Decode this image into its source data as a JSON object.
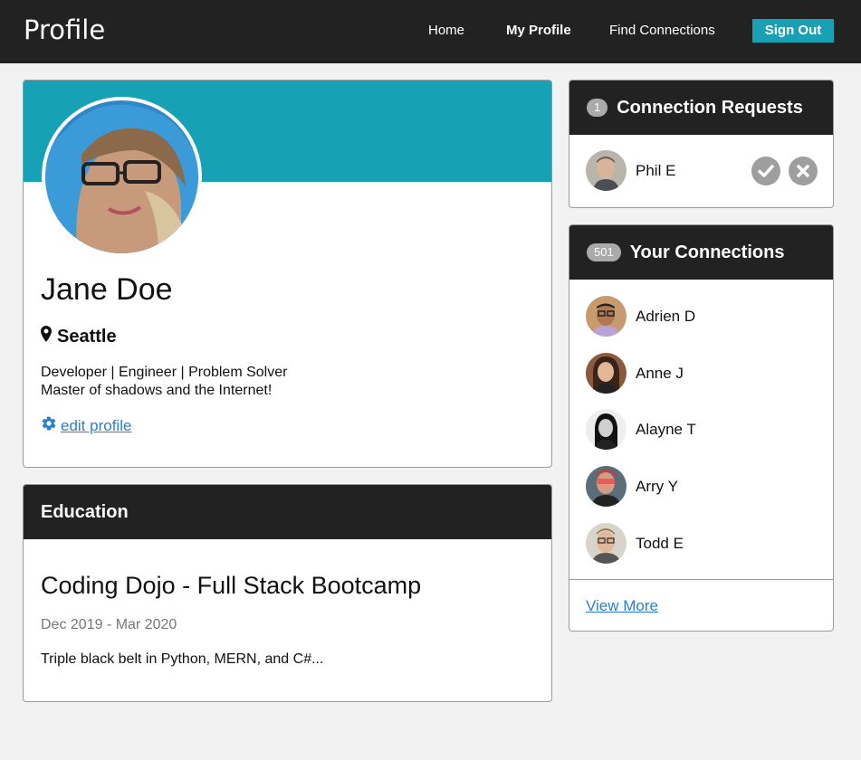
{
  "navbar": {
    "brand": "Profile",
    "links": [
      "Home",
      "My Profile",
      "Find Connections"
    ],
    "signout": "Sign Out",
    "accent": "#1aa0b5"
  },
  "profile": {
    "name": "Jane Doe",
    "location": "Seattle",
    "bio_line1": "Developer | Engineer | Problem Solver",
    "bio_line2": "Master of shadows and the Internet!",
    "edit_label": " edit profile"
  },
  "education": {
    "header": "Education",
    "title": "Coding Dojo - Full Stack Bootcamp",
    "dates": "Dec 2019 - Mar 2020",
    "description": "Triple black belt in Python, MERN, and C#..."
  },
  "requests": {
    "count": "1",
    "header": "Connection Requests",
    "people": [
      {
        "name": "Phil E"
      }
    ]
  },
  "connections": {
    "count": "501",
    "header": "Your Connections",
    "people": [
      {
        "name": "Adrien D"
      },
      {
        "name": "Anne J"
      },
      {
        "name": "Alayne T"
      },
      {
        "name": "Arry Y"
      },
      {
        "name": "Todd E"
      }
    ],
    "view_more": "View More"
  },
  "icons": {
    "location": "map-marker-icon",
    "edit": "gear-icon",
    "accept": "check-circle-icon",
    "decline": "times-circle-icon"
  }
}
